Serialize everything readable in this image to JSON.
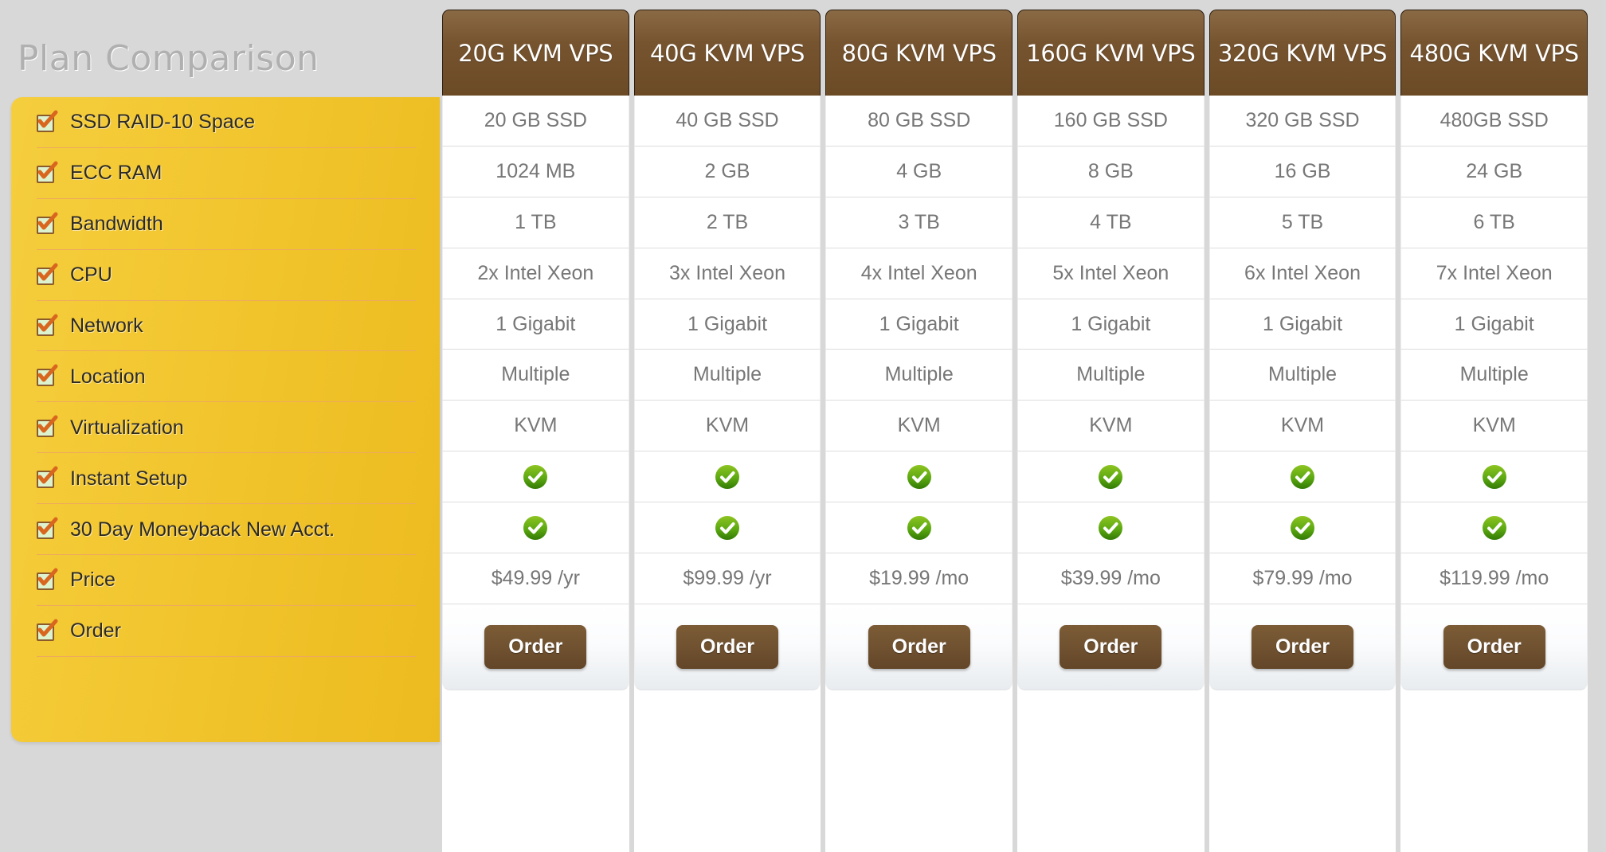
{
  "page": {
    "title": "Plan Comparison"
  },
  "colors": {
    "panel_yellow": "#f2c62f",
    "header_brown": "#6b4a26",
    "button_brown": "#6f5130",
    "check_green": "#5ca811",
    "text_grey": "#777777",
    "title_grey": "#b0b0b0"
  },
  "features": [
    {
      "label": "SSD RAID-10 Space",
      "icon": "checkbox-checked-icon"
    },
    {
      "label": "ECC RAM",
      "icon": "checkbox-checked-icon"
    },
    {
      "label": "Bandwidth",
      "icon": "checkbox-checked-icon"
    },
    {
      "label": "CPU",
      "icon": "checkbox-checked-icon"
    },
    {
      "label": "Network",
      "icon": "checkbox-checked-icon"
    },
    {
      "label": "Location",
      "icon": "checkbox-checked-icon"
    },
    {
      "label": "Virtualization",
      "icon": "checkbox-checked-icon"
    },
    {
      "label": "Instant Setup",
      "icon": "checkbox-checked-icon"
    },
    {
      "label": "30 Day Moneyback New Acct.",
      "icon": "checkbox-checked-icon"
    },
    {
      "label": "Price",
      "icon": "checkbox-checked-icon"
    },
    {
      "label": "Order",
      "icon": "checkbox-checked-icon"
    }
  ],
  "plans": [
    {
      "header": "20G KVM VPS",
      "ssd": "20 GB SSD",
      "ram": "1024 MB",
      "bandwidth": "1 TB",
      "cpu": "2x Intel Xeon",
      "network": "1 Gigabit",
      "location": "Multiple",
      "virtualization": "KVM",
      "instant_setup": "yes",
      "moneyback": "yes",
      "price": "$49.99 /yr",
      "order_label": "Order"
    },
    {
      "header": "40G KVM VPS",
      "ssd": "40 GB SSD",
      "ram": "2 GB",
      "bandwidth": "2 TB",
      "cpu": "3x Intel Xeon",
      "network": "1 Gigabit",
      "location": "Multiple",
      "virtualization": "KVM",
      "instant_setup": "yes",
      "moneyback": "yes",
      "price": "$99.99 /yr",
      "order_label": "Order"
    },
    {
      "header": "80G KVM VPS",
      "ssd": "80 GB SSD",
      "ram": "4 GB",
      "bandwidth": "3 TB",
      "cpu": "4x Intel Xeon",
      "network": "1 Gigabit",
      "location": "Multiple",
      "virtualization": "KVM",
      "instant_setup": "yes",
      "moneyback": "yes",
      "price": "$19.99 /mo",
      "order_label": "Order"
    },
    {
      "header": "160G KVM VPS",
      "ssd": "160 GB SSD",
      "ram": "8 GB",
      "bandwidth": "4 TB",
      "cpu": "5x Intel Xeon",
      "network": "1 Gigabit",
      "location": "Multiple",
      "virtualization": "KVM",
      "instant_setup": "yes",
      "moneyback": "yes",
      "price": "$39.99 /mo",
      "order_label": "Order"
    },
    {
      "header": "320G KVM VPS",
      "ssd": "320 GB SSD",
      "ram": "16 GB",
      "bandwidth": "5 TB",
      "cpu": "6x Intel Xeon",
      "network": "1 Gigabit",
      "location": "Multiple",
      "virtualization": "KVM",
      "instant_setup": "yes",
      "moneyback": "yes",
      "price": "$79.99 /mo",
      "order_label": "Order"
    },
    {
      "header": "480G KVM VPS",
      "ssd": "480GB SSD",
      "ram": "24 GB",
      "bandwidth": "6 TB",
      "cpu": "7x Intel Xeon",
      "network": "1 Gigabit",
      "location": "Multiple",
      "virtualization": "KVM",
      "instant_setup": "yes",
      "moneyback": "yes",
      "price": "$119.99 /mo",
      "order_label": "Order"
    }
  ]
}
